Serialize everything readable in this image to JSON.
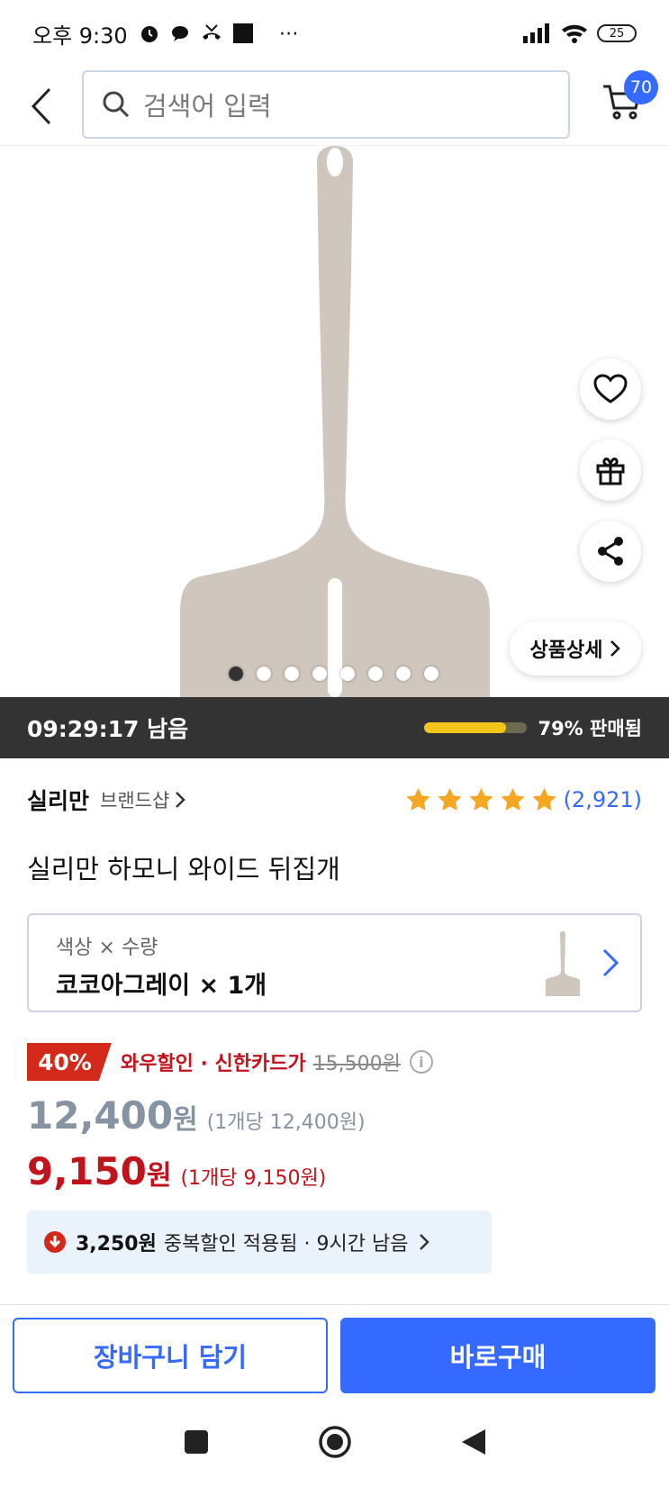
{
  "status_bar": {
    "time": "오후 9:30",
    "battery": "25"
  },
  "header": {
    "search_placeholder": "검색어 입력",
    "cart_count": "70"
  },
  "gallery": {
    "detail_button": "상품상세",
    "image_count": 8,
    "active_index": 0
  },
  "deal": {
    "countdown": "09:29:17 남음",
    "sold_percent": 79,
    "sold_text": "79% 판매됨"
  },
  "product": {
    "brand": "실리만",
    "brand_shop": "브랜드샵",
    "rating_stars": 5,
    "rating_count": "(2,921)",
    "title": "실리만 하모니 와이드 뒤집개"
  },
  "option": {
    "label": "색상 × 수량",
    "value": "코코아그레이 × 1개"
  },
  "pricing": {
    "discount_badge": "40%",
    "wow_label": "와우할인 · 신한카드가",
    "original_price": "15,500원",
    "sale_price": "12,400",
    "sale_won": "원",
    "sale_unit": "(1개당 12,400원)",
    "final_price": "9,150",
    "final_won": "원",
    "final_unit": "(1개당 9,150원)"
  },
  "coupon": {
    "amount": "3,250원",
    "text": "중복할인 적용됨 · 9시간 남음"
  },
  "actions": {
    "add_to_cart": "장바구니 담기",
    "buy_now": "바로구매"
  },
  "colors": {
    "accent": "#346aff",
    "sale_red": "#c1131b",
    "timer_bg": "#333333",
    "progress_yellow": "#f5c518",
    "star": "#f5a623",
    "product_color": "#cfc6bd"
  }
}
